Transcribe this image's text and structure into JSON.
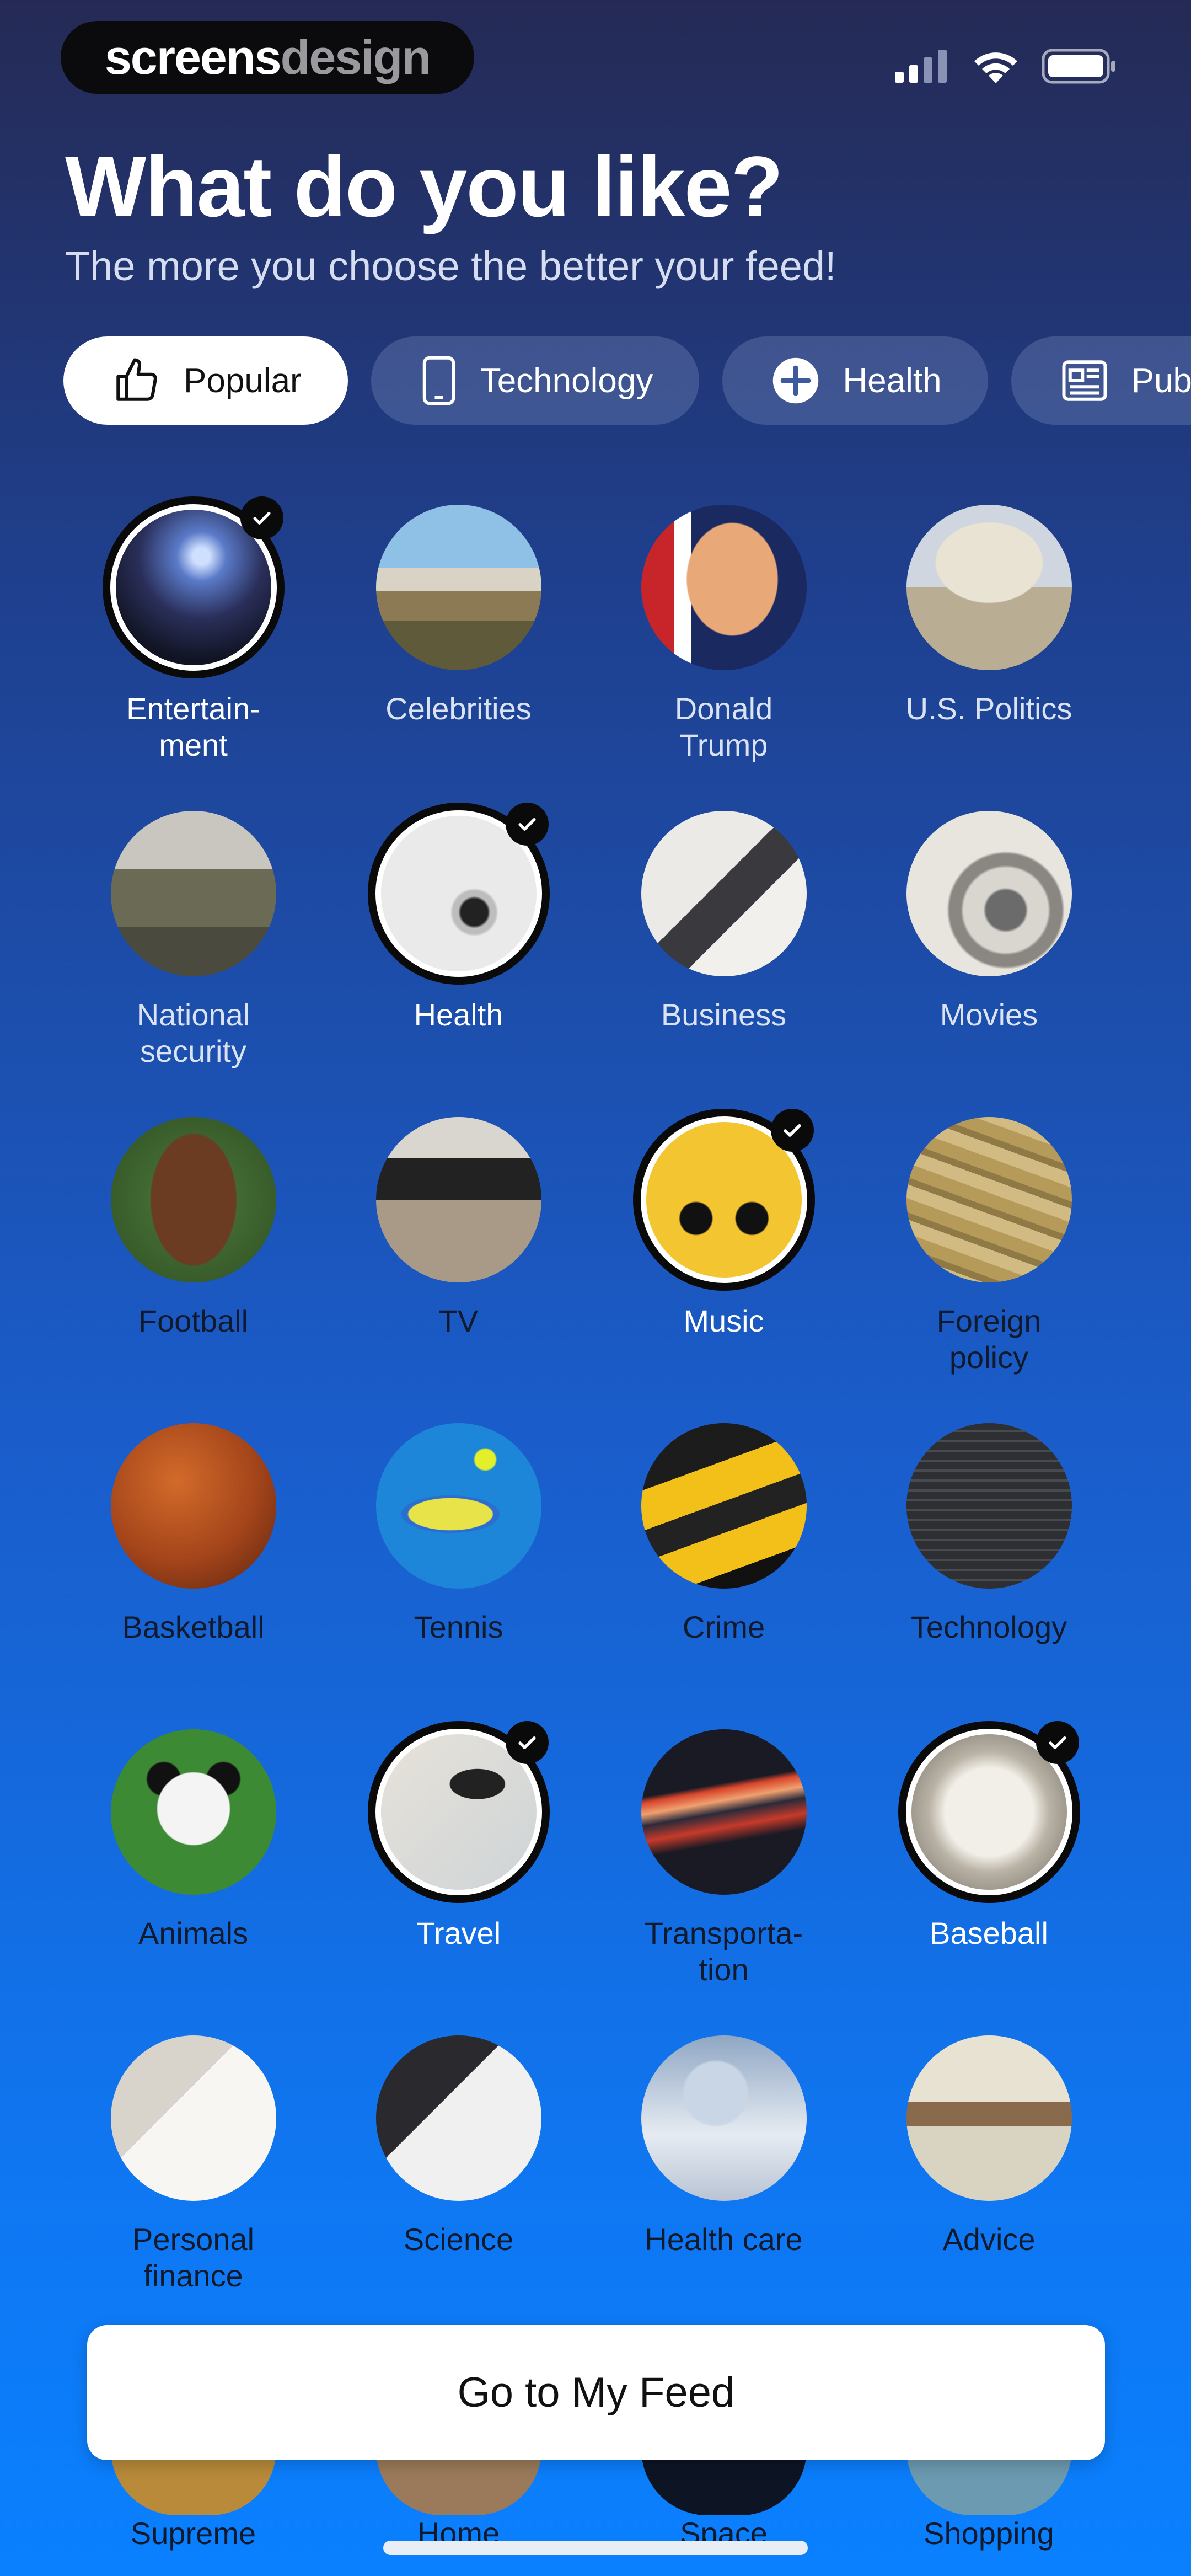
{
  "status": {
    "brand_left": "screens",
    "brand_right": "design"
  },
  "header": {
    "title": "What do you like?",
    "subtitle": "The more you choose the better your feed!"
  },
  "chips": [
    {
      "label": "Popular",
      "icon": "thumbs-up-icon",
      "active": true
    },
    {
      "label": "Technology",
      "icon": "phone-icon",
      "active": false
    },
    {
      "label": "Health",
      "icon": "plus-circle-icon",
      "active": false
    },
    {
      "label": "Pub",
      "icon": "newspaper-icon",
      "active": false
    }
  ],
  "topics": [
    [
      {
        "label": "Entertain-\nment",
        "selected": true
      },
      {
        "label": "Celebrities",
        "selected": false
      },
      {
        "label": "Donald\nTrump",
        "selected": false
      },
      {
        "label": "U.S. Politics",
        "selected": false
      }
    ],
    [
      {
        "label": "National\nsecurity",
        "selected": false
      },
      {
        "label": "Health",
        "selected": true
      },
      {
        "label": "Business",
        "selected": false
      },
      {
        "label": "Movies",
        "selected": false
      }
    ],
    [
      {
        "label": "Football",
        "selected": false
      },
      {
        "label": "TV",
        "selected": false
      },
      {
        "label": "Music",
        "selected": true
      },
      {
        "label": "Foreign\npolicy",
        "selected": false
      }
    ],
    [
      {
        "label": "Basketball",
        "selected": false
      },
      {
        "label": "Tennis",
        "selected": false
      },
      {
        "label": "Crime",
        "selected": false
      },
      {
        "label": "Technology",
        "selected": false
      }
    ],
    [
      {
        "label": "Animals",
        "selected": false
      },
      {
        "label": "Travel",
        "selected": true
      },
      {
        "label": "Transporta-\ntion",
        "selected": false
      },
      {
        "label": "Baseball",
        "selected": true
      }
    ],
    [
      {
        "label": "Personal\nfinance",
        "selected": false
      },
      {
        "label": "Science",
        "selected": false
      },
      {
        "label": "Health care",
        "selected": false
      },
      {
        "label": "Advice",
        "selected": false
      }
    ]
  ],
  "bottom_topics": [
    "Supreme",
    "Home",
    "Space",
    "Shopping"
  ],
  "cta": {
    "label": "Go to My Feed"
  },
  "colors": {
    "accent": "#0a80ff",
    "selected_ring": "#ffffff"
  }
}
